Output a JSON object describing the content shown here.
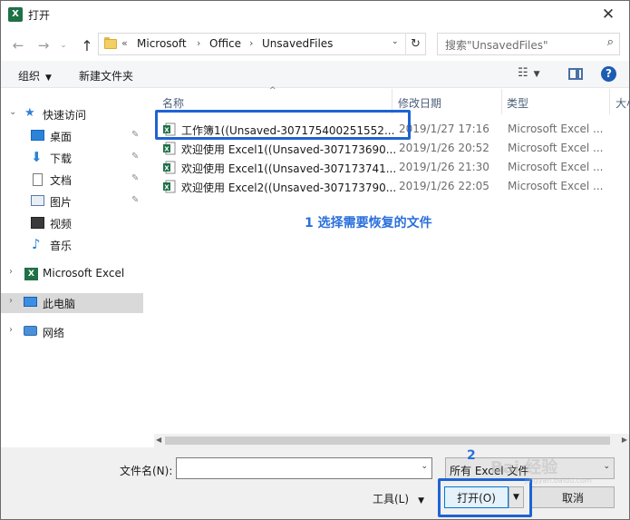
{
  "window": {
    "title": "打开",
    "app_icon": "excel-icon",
    "close_glyph": "✕"
  },
  "nav": {
    "back_glyph": "←",
    "forward_glyph": "→",
    "recent_glyph": "⌄",
    "up_glyph": "↑",
    "breadcrumb": [
      "Microsoft",
      "Office",
      "UnsavedFiles"
    ],
    "breadcrumb_overflow": "«",
    "search_placeholder": "搜索\"UnsavedFiles\""
  },
  "toolbar": {
    "organize": "组织",
    "new_folder": "新建文件夹"
  },
  "sidebar": {
    "items": [
      {
        "label": "快速访问",
        "icon": "star-icon",
        "group": true
      },
      {
        "label": "桌面",
        "icon": "desktop-icon",
        "pinned": true
      },
      {
        "label": "下载",
        "icon": "download-icon",
        "pinned": true
      },
      {
        "label": "文档",
        "icon": "document-icon",
        "pinned": true
      },
      {
        "label": "图片",
        "icon": "picture-icon",
        "pinned": true
      },
      {
        "label": "视频",
        "icon": "video-icon"
      },
      {
        "label": "音乐",
        "icon": "music-icon"
      },
      {
        "label": "Microsoft Excel",
        "icon": "excel-icon",
        "group": true
      },
      {
        "label": "此电脑",
        "icon": "computer-icon",
        "group": true,
        "selected": true
      },
      {
        "label": "网络",
        "icon": "network-icon",
        "group": true
      }
    ]
  },
  "columns": {
    "name": "名称",
    "modified": "修改日期",
    "type": "类型",
    "size": "大小"
  },
  "files": [
    {
      "name": "工作簿1((Unsaved-307175400251552...",
      "modified": "2019/1/27 17:16",
      "type": "Microsoft Excel ..."
    },
    {
      "name": "欢迎使用 Excel1((Unsaved-307173690...",
      "modified": "2019/1/26 20:52",
      "type": "Microsoft Excel ..."
    },
    {
      "name": "欢迎使用 Excel1((Unsaved-307173741...",
      "modified": "2019/1/26 21:30",
      "type": "Microsoft Excel ..."
    },
    {
      "name": "欢迎使用 Excel2((Unsaved-307173790...",
      "modified": "2019/1/26 22:05",
      "type": "Microsoft Excel ..."
    }
  ],
  "annotations": {
    "step1": "1 选择需要恢复的文件",
    "step2": "2"
  },
  "bottom": {
    "filename_label": "文件名(N):",
    "filename_value": "",
    "filter_value": "所有 Excel 文件",
    "tools": "工具(L)",
    "open": "打开(O)",
    "cancel": "取消"
  },
  "watermark": {
    "text": "Bai  经验",
    "sub": "jingyan.baidu.com"
  },
  "colors": {
    "accent": "#1e63d3",
    "annotation": "#2a6fdb",
    "excel": "#1e7145",
    "selected": "#d9d9d9"
  }
}
